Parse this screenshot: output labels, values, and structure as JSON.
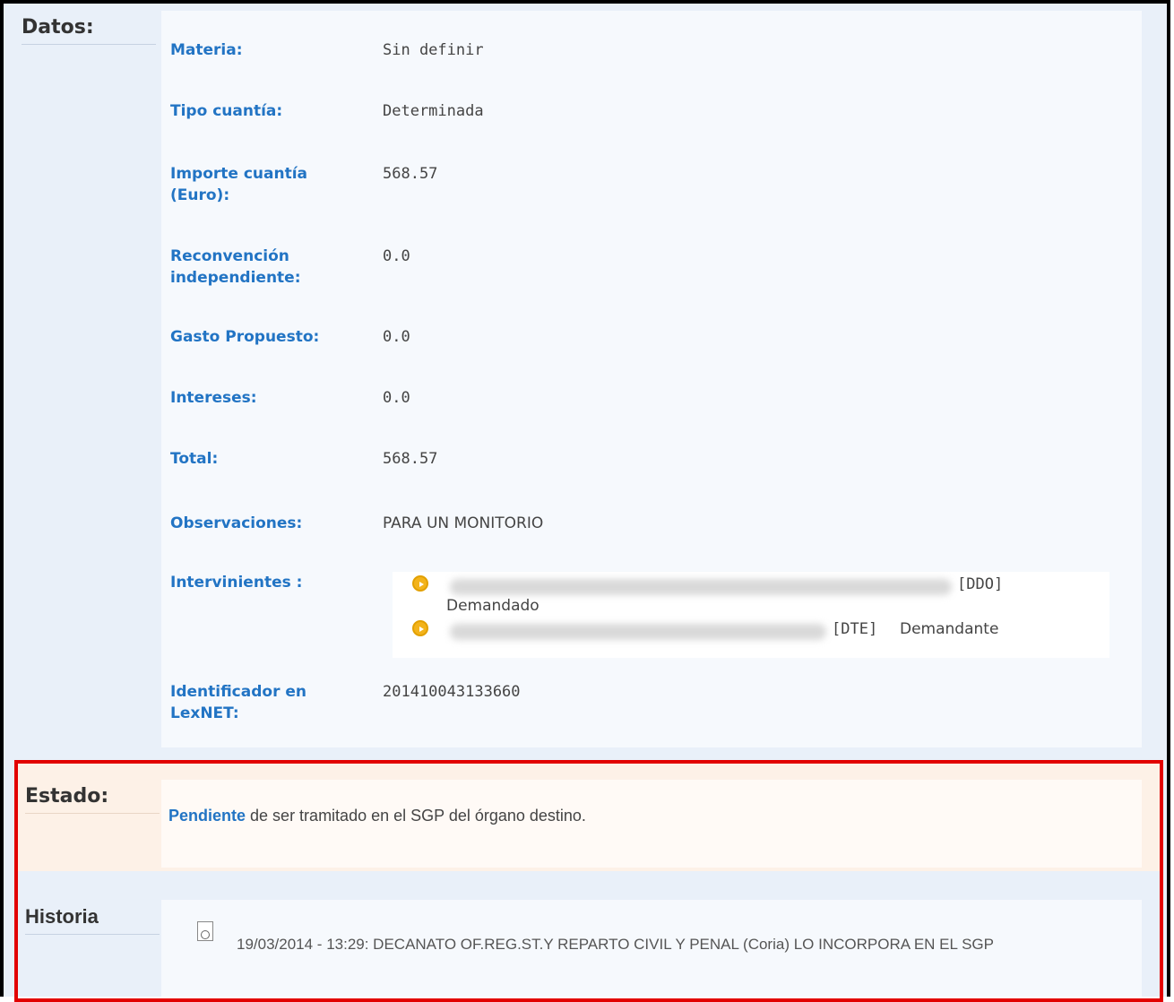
{
  "datos": {
    "title": "Datos:",
    "rows": [
      {
        "label": "Materia:",
        "value": "Sin definir"
      },
      {
        "label": "Tipo cuantía:",
        "value": "Determinada"
      },
      {
        "label": "Importe cuantía (Euro):",
        "value": "568.57"
      },
      {
        "label": "Reconvención independiente:",
        "value": "0.0"
      },
      {
        "label": "Gasto Propuesto:",
        "value": "0.0"
      },
      {
        "label": "Intereses:",
        "value": "0.0"
      },
      {
        "label": "Total:",
        "value": "568.57"
      },
      {
        "label": "Observaciones:",
        "value": "PARA UN MONITORIO"
      }
    ],
    "intervinientes": {
      "label": "Intervinientes :",
      "items": [
        {
          "role_code": "[DDO]",
          "role_name": "Demandado"
        },
        {
          "role_code": "[DTE]",
          "role_name": "Demandante"
        }
      ]
    },
    "lexnet": {
      "label": "Identificador en LexNET:",
      "value": "201410043133660"
    }
  },
  "estado": {
    "title": "Estado:",
    "highlight": "Pendiente",
    "text": " de ser tramitado en el SGP del órgano destino."
  },
  "historia": {
    "title": "Historia",
    "entries": [
      {
        "text": "19/03/2014 - 13:29: DECANATO OF.REG.ST.Y REPARTO CIVIL Y PENAL (Coria) LO INCORPORA EN EL SGP"
      }
    ]
  },
  "colors": {
    "label_blue": "#2274c4",
    "highlight_red": "#e20000",
    "bullet": "#f3b31a"
  }
}
